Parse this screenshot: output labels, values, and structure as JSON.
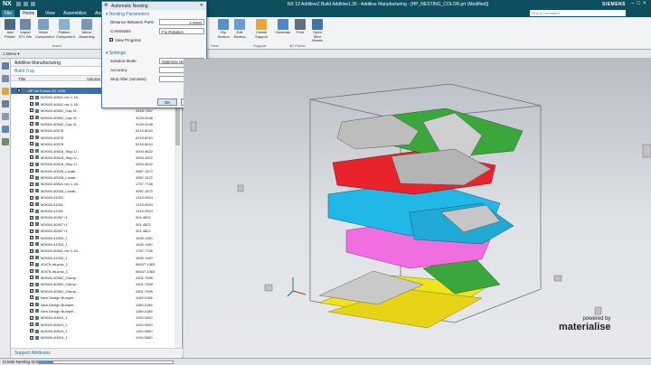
{
  "titlebar": {
    "app": "NX",
    "title": "NX 12 Additive2 Build Additive1.35 - Additive Manufacturing - [HP_NESTING_COLOR.prt (Modified)]",
    "brand": "SIEMENS"
  },
  "tabs": [
    "File",
    "Home",
    "View",
    "Assemblies",
    "Analys"
  ],
  "search_placeholder": "Find a Command",
  "ribbon_left": [
    {
      "label": "Add Printer",
      "icon": "printer-icon"
    },
    {
      "label": "Import STL File",
      "icon": "import-icon"
    },
    {
      "label": "Move Component",
      "icon": "move-icon"
    },
    {
      "label": "Pattern Component",
      "icon": "pattern-icon"
    },
    {
      "label": "Mirror Assembly",
      "icon": "mirror-icon"
    }
  ],
  "ribbon_group_left": "Insert",
  "ribbon_right": [
    {
      "label": "Clip Section",
      "icon": "clip-section-icon"
    },
    {
      "label": "Edit Section",
      "icon": "edit-section-icon"
    },
    {
      "label": "Create Support",
      "icon": "support-icon"
    },
    {
      "label": "Generate",
      "icon": "generate-icon"
    },
    {
      "label": "Print",
      "icon": "print-icon"
    },
    {
      "label": "Open Slice Viewer",
      "icon": "slice-viewer-icon"
    }
  ],
  "ribbon_groups_right": [
    "View",
    "Support",
    "3D Printer"
  ],
  "menu_label": "Menu",
  "navigator": {
    "heading": "Additive Manufacturing",
    "subheading": "Build Tray",
    "col_title": "Title",
    "col_volume": "Volume",
    "rows": [
      {
        "name": "HP Jet Fusion 3D 4200",
        "vol": "",
        "sel": true
      },
      {
        "name": "M2K65-40841 rev 1.18...",
        "vol": "3158.5247"
      },
      {
        "name": "M2K65-40841 rev 1.18...",
        "vol": "1757.7745"
      },
      {
        "name": "M2K65-40552_Cap Vi...",
        "vol": "2618.7357"
      },
      {
        "name": "M2K65-40552_Cap Vi...",
        "vol": "3129.0248"
      },
      {
        "name": "M2K65-40552_Cap Vi...",
        "vol": "3129.0248"
      },
      {
        "name": "M2K65-40578",
        "vol": "6215.8010"
      },
      {
        "name": "M2K65-40578",
        "vol": "6215.8010"
      },
      {
        "name": "M2K65-40578",
        "vol": "6215.8010"
      },
      {
        "name": "M2K65-40618_Stop U...",
        "vol": "4004.4622"
      },
      {
        "name": "M2K65-40618_Stop U...",
        "vol": "4004.4622"
      },
      {
        "name": "M2K65-40618_Stop U...",
        "vol": "4004.4622"
      },
      {
        "name": "M2K65-40028_Locati...",
        "vol": "3987.1572"
      },
      {
        "name": "M2K65-40028_Locati...",
        "vol": "3987.1572"
      },
      {
        "name": "M2K65-40841 rev 1.18...",
        "vol": "1757.7745"
      },
      {
        "name": "M2K65-40028_Locati...",
        "vol": "3987.1572"
      },
      {
        "name": "M2K65-41051",
        "vol": "1319.0924"
      },
      {
        "name": "M2K65-41051",
        "vol": "1319.0924"
      },
      {
        "name": "M2K65-41051",
        "vol": "1319.0924"
      },
      {
        "name": "M2K65-40457 r1",
        "vol": "301.4822"
      },
      {
        "name": "M2K65-40457 r1",
        "vol": "301.4822"
      },
      {
        "name": "M2K65-40457 r1",
        "vol": "301.4822"
      },
      {
        "name": "M2K65-41053_1",
        "vol": "1630.1190"
      },
      {
        "name": "M2K65-41053_1",
        "vol": "1630.1190"
      },
      {
        "name": "M2K65-40841 rev 1.18...",
        "vol": "1757.7745"
      },
      {
        "name": "M2K65-41053_1",
        "vol": "1630.1190"
      },
      {
        "name": "40475-alt-post_1",
        "vol": "56047.1363"
      },
      {
        "name": "40475-alt-post_1",
        "vol": "56047.1363"
      },
      {
        "name": "M2K65-40552_Clamp ...",
        "vol": "4301.7599"
      },
      {
        "name": "M2K65-40552_Clamp ...",
        "vol": "4301.7599"
      },
      {
        "name": "M2K65-40552_Clamp ...",
        "vol": "4301.7599"
      },
      {
        "name": "New Design Bumper...",
        "vol": "1189.0156"
      },
      {
        "name": "New Design Bumper...",
        "vol": "1189.0156"
      },
      {
        "name": "New Design Bumper...",
        "vol": "1189.0156"
      },
      {
        "name": "M2K65-40619_1",
        "vol": "1100.0000"
      },
      {
        "name": "M2K65-40619_1",
        "vol": "1100.0000"
      },
      {
        "name": "M2K65-40619_1",
        "vol": "1100.0000"
      },
      {
        "name": "M2K65-40619_1",
        "vol": "1100.0000"
      }
    ],
    "footer": "Support Attributes"
  },
  "dialog": {
    "title": "Automatic Nesting",
    "section1": "Nesting Parameters",
    "distance_label": "Distance Between Parts",
    "distance_value": "2.0000",
    "constraints_label": "Constraints",
    "constraints_value": "Fix Rotation",
    "view_progress_label": "View Progress",
    "section2": "Settings",
    "solution_mode_label": "Solution Mode",
    "solution_mode_value": "Optimize Height",
    "accuracy_label": "Accuracy",
    "accuracy_value": "1.5000",
    "stop_after_label": "Stop After (minutes)",
    "stop_after_value": "2",
    "ok_label": "OK",
    "cancel_label": "Cancel"
  },
  "status": {
    "text": "Create Nesting 11%",
    "progress": 0.11
  },
  "branding": {
    "powered_by": "powered by",
    "name": "materialise"
  },
  "colors": {
    "titlebar": "#0d4e5f",
    "yellow": "#f2e21a",
    "red": "#e8232b",
    "blue": "#21b7e6",
    "pink": "#f06ee0",
    "green": "#3aa63c",
    "gray": "#c9c9c9"
  }
}
